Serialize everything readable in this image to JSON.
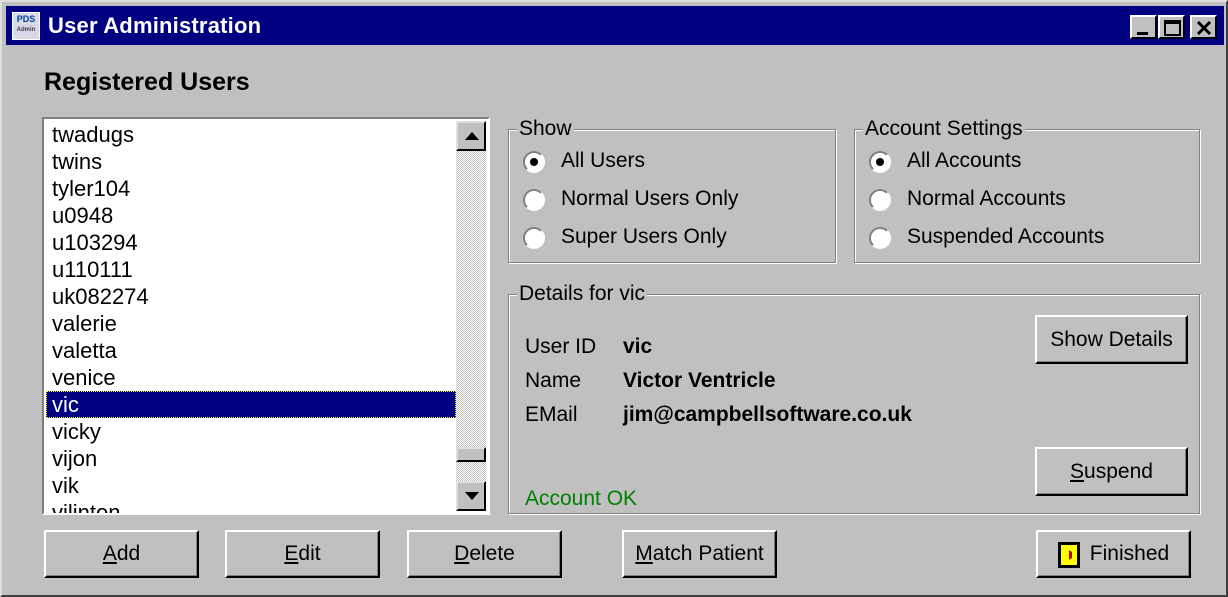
{
  "window": {
    "title": "User Administration",
    "icon_top": "PDS",
    "icon_bottom": "Admin",
    "buttons": [
      "minimize-icon",
      "maximize-icon",
      "close-icon"
    ]
  },
  "heading": "Registered Users",
  "users": {
    "items": [
      "twadugs",
      "twins",
      "tyler104",
      "u0948",
      "u103294",
      "u110111",
      "uk082274",
      "valerie",
      "valetta",
      "venice",
      "vic",
      "vicky",
      "vijon",
      "vik",
      "vilinton"
    ],
    "selected": "vic"
  },
  "show_group": {
    "title": "Show",
    "options": [
      "All Users",
      "Normal Users Only",
      "Super Users Only"
    ],
    "selected_index": 0
  },
  "account_group": {
    "title": "Account Settings",
    "options": [
      "All Accounts",
      "Normal Accounts",
      "Suspended Accounts"
    ],
    "selected_index": 0
  },
  "details": {
    "title": "Details for vic",
    "user_id_label": "User ID",
    "user_id": "vic",
    "name_label": "Name",
    "name": "Victor Ventricle",
    "email_label": "EMail",
    "email": "jim@campbellsoftware.co.uk",
    "status": "Account OK",
    "status_color": "#008000",
    "show_details_label": "Show Details",
    "suspend_mnemonic": "S",
    "suspend_rest": "uspend"
  },
  "buttons": {
    "add_mnemonic": "A",
    "add_rest": "dd",
    "edit_mnemonic": "E",
    "edit_rest": "dit",
    "delete_mnemonic": "D",
    "delete_rest": "elete",
    "match_mnemonic": "M",
    "match_rest": "atch Patient",
    "finished": "Finished"
  },
  "colors": {
    "titlebar": "#000080",
    "face": "#c0c0c0",
    "selection": "#000080"
  }
}
